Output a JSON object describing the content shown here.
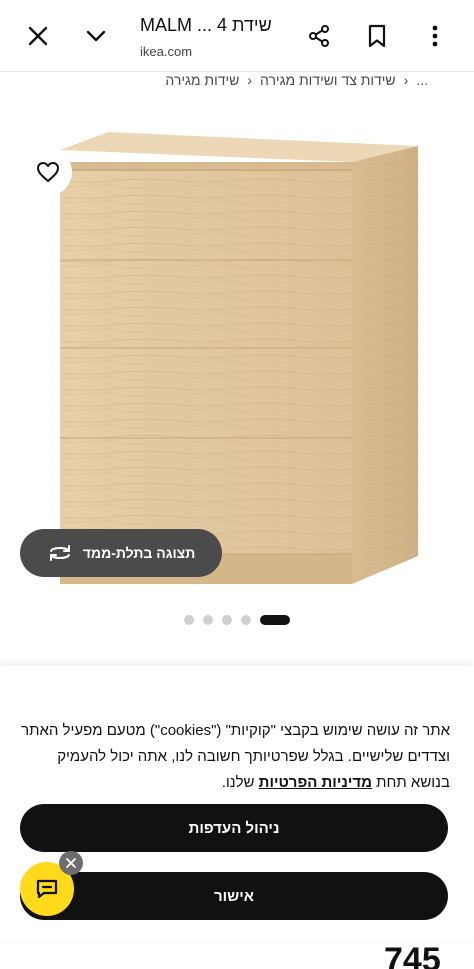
{
  "browser": {
    "title": "MALM ... שידת 4",
    "domain": "ikea.com"
  },
  "breadcrumb": {
    "items": [
      "...",
      "שידות צד ושידות מגירה",
      "שידות מגירה"
    ]
  },
  "product": {
    "view_3d_label": "תצוגה בתלת-ממד",
    "gallery": {
      "total_images": 5,
      "active_index": 4
    }
  },
  "cookie": {
    "text_main": "אתר זה עושה שימוש בקבצי \"קוקיות\" (\"cookies\") מטעם מפעיל האתר וצדדים שלישיים. בגלל שפרטיותך חשובה לנו, אתה יכול להעמיק בנושא תחת ",
    "privacy_link": "מדיניות הפרטיות",
    "text_end": " שלנו.",
    "manage_label": "ניהול העדפות",
    "accept_label": "אישור"
  },
  "price_peek": "745",
  "colors": {
    "accent_yellow": "#ffda1a",
    "dark_pill": "#111111",
    "view3d_bg": "#4b4b4b"
  },
  "icons": [
    "close-icon",
    "chevron-down-icon",
    "share-icon",
    "bookmark-icon",
    "more-vert-icon",
    "heart-icon",
    "rotate-3d-icon",
    "chat-icon",
    "close-small-icon"
  ]
}
